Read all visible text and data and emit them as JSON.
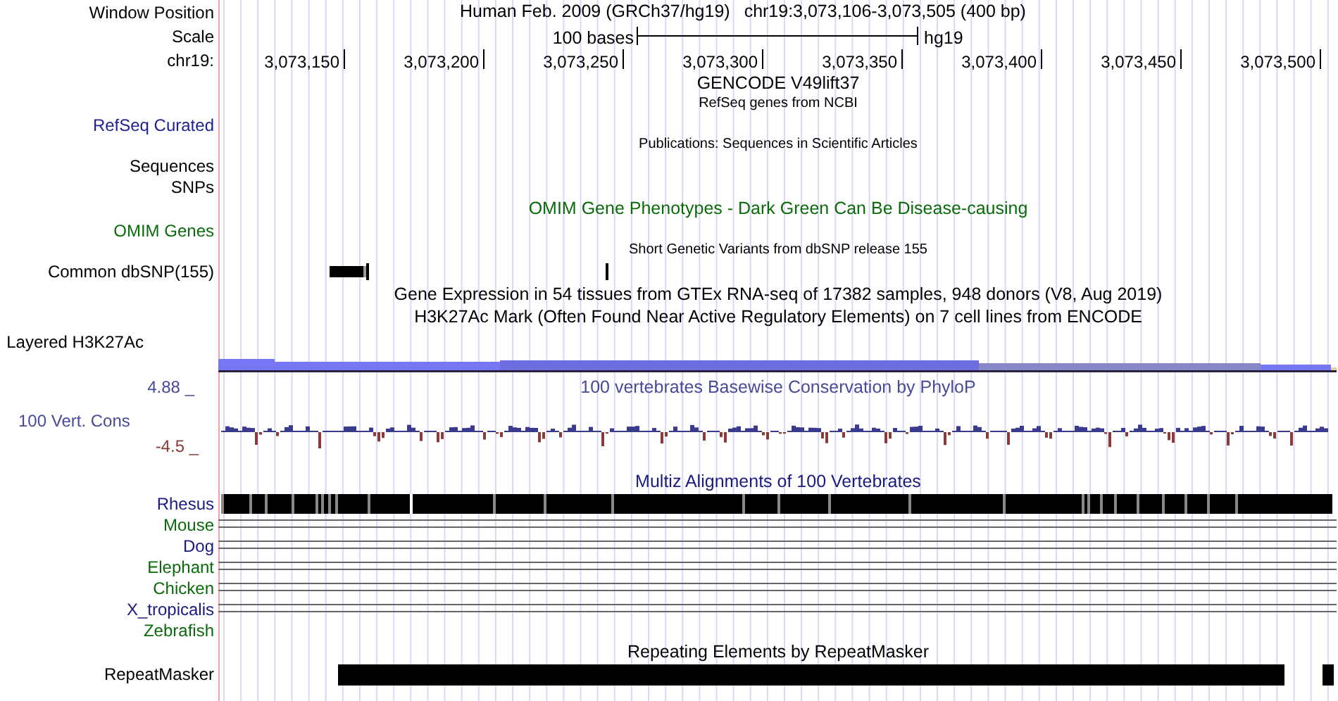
{
  "header": {
    "label": "Window Position",
    "assembly": "Human Feb. 2009 (GRCh37/hg19)",
    "position": "chr19:3,073,106-3,073,505 (400 bp)"
  },
  "scale": {
    "label": "Scale",
    "span": "100 bases",
    "genome": "hg19"
  },
  "ruler": {
    "label": "chr19:",
    "ticks": [
      "3,073,150",
      "3,073,200",
      "3,073,250",
      "3,073,300",
      "3,073,350",
      "3,073,400",
      "3,073,450",
      "3,073,500"
    ]
  },
  "rows": [
    {
      "kind": "title",
      "text": "GENCODE V49lift37",
      "color": "#000000"
    },
    {
      "kind": "caption",
      "text": "RefSeq genes from NCBI",
      "color": "#000000"
    },
    {
      "kind": "label",
      "label": "RefSeq Curated",
      "color": "#1f1f8f"
    },
    {
      "kind": "caption",
      "text": "Publications: Sequences in Scientific Articles",
      "color": "#000000"
    },
    {
      "kind": "label",
      "label": "Sequences",
      "color": "#000000"
    },
    {
      "kind": "label",
      "label": "SNPs",
      "color": "#000000"
    },
    {
      "kind": "title",
      "text": "OMIM Gene Phenotypes - Dark Green Can Be Disease-causing",
      "color": "#0b6b0b"
    },
    {
      "kind": "label",
      "label": "OMIM Genes",
      "color": "#0b6b0b"
    },
    {
      "kind": "caption",
      "text": "Short Genetic Variants from dbSNP release 155",
      "color": "#000000"
    },
    {
      "kind": "snp",
      "label": "Common dbSNP(155)",
      "color": "#000000"
    },
    {
      "kind": "title",
      "text": "Gene Expression in 54 tissues from GTEx RNA-seq of 17382 samples, 948 donors (V8, Aug 2019)",
      "color": "#000000"
    },
    {
      "kind": "title",
      "text": "H3K27Ac Mark (Often Found Near Active Regulatory Elements) on 7 cell lines from ENCODE",
      "color": "#000000"
    },
    {
      "kind": "layered",
      "label": "Layered H3K27Ac",
      "color": "#000000"
    },
    {
      "kind": "wiggle",
      "title": "100 vertebrates Basewise Conservation by PhyloP",
      "label": "100 Vert. Cons",
      "max": "4.88 _",
      "min": "-4.5 _",
      "color": "#4a4a9a"
    },
    {
      "kind": "title",
      "text": "Multiz Alignments of 100 Vertebrates",
      "color": "#1a1a80"
    },
    {
      "kind": "blocks",
      "label": "Rhesus",
      "color": "#1a1a80"
    },
    {
      "kind": "lines",
      "label": "Mouse",
      "color": "#0b6b0b"
    },
    {
      "kind": "lines",
      "label": "Dog",
      "color": "#1a1a80"
    },
    {
      "kind": "lines",
      "label": "Elephant",
      "color": "#0b6b0b"
    },
    {
      "kind": "lines",
      "label": "Chicken",
      "color": "#0b6b0b"
    },
    {
      "kind": "lines",
      "label": "X_tropicalis",
      "color": "#1a1a80"
    },
    {
      "kind": "empty",
      "label": "Zebrafish",
      "color": "#0b6b0b"
    },
    {
      "kind": "title",
      "text": "Repeating Elements by RepeatMasker",
      "color": "#000000"
    },
    {
      "kind": "repeat",
      "label": "RepeatMasker",
      "color": "#000000"
    }
  ]
}
